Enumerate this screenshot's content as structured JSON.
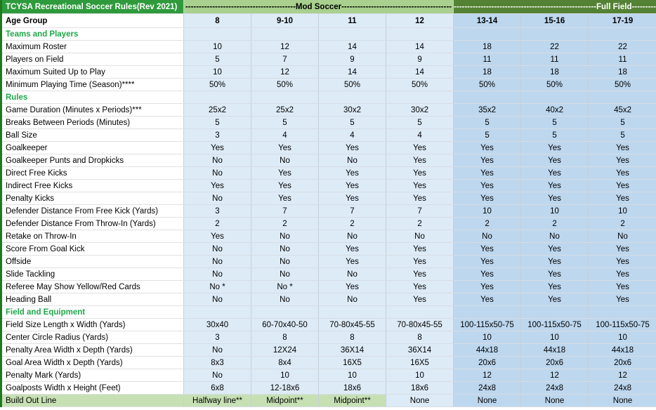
{
  "header": {
    "title": "TCYSA Recreational Soccer Rules(Rev 2021)",
    "mod_label": "-----------------------------------------Mod Soccer-----------------------------------------",
    "full_label": "-----------------------------------------------------Full Field-----------------------------------------------------"
  },
  "age_group": {
    "label": "Age Group",
    "values": [
      "8",
      "9-10",
      "11",
      "12",
      "13-14",
      "15-16",
      "17-19"
    ]
  },
  "sections": [
    {
      "type": "section",
      "label": "Teams and Players"
    },
    {
      "type": "row",
      "label": "Maximum Roster",
      "values": [
        "10",
        "12",
        "14",
        "14",
        "18",
        "22",
        "22"
      ]
    },
    {
      "type": "row",
      "label": "Players on Field",
      "values": [
        "5",
        "7",
        "9",
        "9",
        "11",
        "11",
        "11"
      ]
    },
    {
      "type": "row",
      "label": "Maximum Suited Up to Play",
      "values": [
        "10",
        "12",
        "14",
        "14",
        "18",
        "18",
        "18"
      ]
    },
    {
      "type": "row",
      "label": "Minimum Playing Time (Season)****",
      "values": [
        "50%",
        "50%",
        "50%",
        "50%",
        "50%",
        "50%",
        "50%"
      ]
    },
    {
      "type": "section",
      "label": "Rules"
    },
    {
      "type": "row",
      "label": "Game Duration (Minutes x Periods)***",
      "values": [
        "25x2",
        "25x2",
        "30x2",
        "30x2",
        "35x2",
        "40x2",
        "45x2"
      ]
    },
    {
      "type": "row",
      "label": "Breaks Between Periods (Minutes)",
      "values": [
        "5",
        "5",
        "5",
        "5",
        "5",
        "5",
        "5"
      ]
    },
    {
      "type": "row",
      "label": "Ball Size",
      "values": [
        "3",
        "4",
        "4",
        "4",
        "5",
        "5",
        "5"
      ]
    },
    {
      "type": "row",
      "label": "Goalkeeper",
      "values": [
        "Yes",
        "Yes",
        "Yes",
        "Yes",
        "Yes",
        "Yes",
        "Yes"
      ]
    },
    {
      "type": "row",
      "label": "Goalkeeper Punts and Dropkicks",
      "values": [
        "No",
        "No",
        "No",
        "Yes",
        "Yes",
        "Yes",
        "Yes"
      ]
    },
    {
      "type": "row",
      "label": "Direct Free Kicks",
      "values": [
        "No",
        "Yes",
        "Yes",
        "Yes",
        "Yes",
        "Yes",
        "Yes"
      ]
    },
    {
      "type": "row",
      "label": "Indirect Free Kicks",
      "values": [
        "Yes",
        "Yes",
        "Yes",
        "Yes",
        "Yes",
        "Yes",
        "Yes"
      ]
    },
    {
      "type": "row",
      "label": "Penalty Kicks",
      "values": [
        "No",
        "Yes",
        "Yes",
        "Yes",
        "Yes",
        "Yes",
        "Yes"
      ]
    },
    {
      "type": "row",
      "label": "Defender Distance From Free Kick (Yards)",
      "values": [
        "3",
        "7",
        "7",
        "7",
        "10",
        "10",
        "10"
      ]
    },
    {
      "type": "row",
      "label": "Defender Distance From Throw-In (Yards)",
      "values": [
        "2",
        "2",
        "2",
        "2",
        "2",
        "2",
        "2"
      ]
    },
    {
      "type": "row",
      "label": "Retake on Throw-In",
      "values": [
        "Yes",
        "No",
        "No",
        "No",
        "No",
        "No",
        "No"
      ]
    },
    {
      "type": "row",
      "label": "Score From Goal Kick",
      "values": [
        "No",
        "No",
        "Yes",
        "Yes",
        "Yes",
        "Yes",
        "Yes"
      ]
    },
    {
      "type": "row",
      "label": "Offside",
      "values": [
        "No",
        "No",
        "Yes",
        "Yes",
        "Yes",
        "Yes",
        "Yes"
      ]
    },
    {
      "type": "row",
      "label": "Slide Tackling",
      "values": [
        "No",
        "No",
        "No",
        "Yes",
        "Yes",
        "Yes",
        "Yes"
      ]
    },
    {
      "type": "row",
      "label": "Referee May Show Yellow/Red Cards",
      "values": [
        "No *",
        "No *",
        "Yes",
        "Yes",
        "Yes",
        "Yes",
        "Yes"
      ]
    },
    {
      "type": "row",
      "label": "Heading Ball",
      "values": [
        "No",
        "No",
        "No",
        "Yes",
        "Yes",
        "Yes",
        "Yes"
      ]
    },
    {
      "type": "section",
      "label": "Field and Equipment"
    },
    {
      "type": "row",
      "label": "Field Size Length x Width (Yards)",
      "values": [
        "30x40",
        "60-70x40-50",
        "70-80x45-55",
        "70-80x45-55",
        "100-115x50-75",
        "100-115x50-75",
        "100-115x50-75"
      ]
    },
    {
      "type": "row",
      "label": "Center Circle Radius (Yards)",
      "values": [
        "3",
        "8",
        "8",
        "8",
        "10",
        "10",
        "10"
      ]
    },
    {
      "type": "row",
      "label": "Penalty Area Width x Depth (Yards)",
      "values": [
        "No",
        "12X24",
        "36X14",
        "36X14",
        "44x18",
        "44x18",
        "44x18"
      ]
    },
    {
      "type": "row",
      "label": "Goal Area Width x Depth (Yards)",
      "values": [
        "8x3",
        "8x4",
        "16X5",
        "16X5",
        "20x6",
        "20x6",
        "20x6"
      ]
    },
    {
      "type": "row",
      "label": "Penalty Mark (Yards)",
      "values": [
        "No",
        "10",
        "10",
        "10",
        "12",
        "12",
        "12"
      ]
    },
    {
      "type": "row",
      "label": "Goalposts Width x Height (Feet)",
      "values": [
        "6x8",
        "12-18x6",
        "18x6",
        "18x6",
        "24x8",
        "24x8",
        "24x8"
      ]
    },
    {
      "type": "last",
      "label": "Build Out Line",
      "values": [
        "Halfway line**",
        "Midpoint**",
        "Midpoint**",
        "None",
        "None",
        "None",
        "None"
      ]
    }
  ]
}
